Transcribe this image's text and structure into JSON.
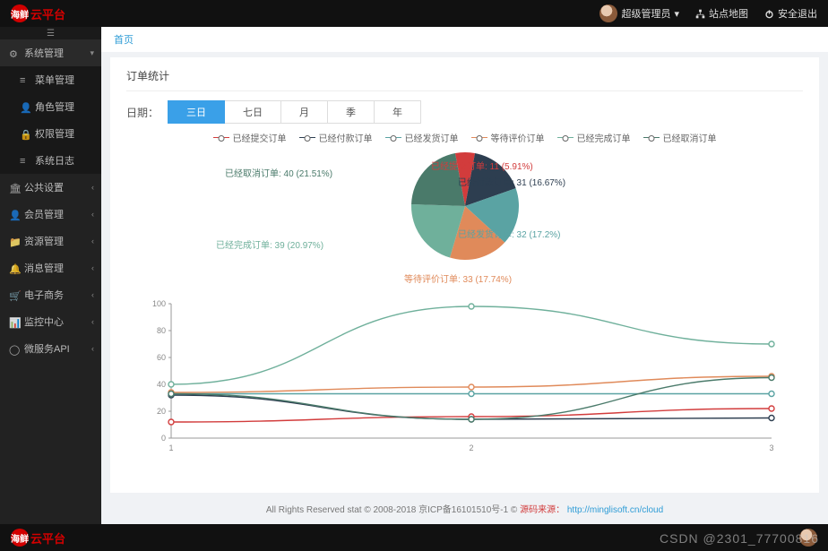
{
  "brand": {
    "badge": "海鲜",
    "text": "云平台"
  },
  "topbar": {
    "user": "超级管理员",
    "sitemap": "站点地图",
    "logout": "安全退出"
  },
  "sidebar": {
    "groups": [
      {
        "icon": "gears",
        "label": "系统管理",
        "caret": "down",
        "active": true
      },
      {
        "sub": true,
        "icon": "list",
        "label": "菜单管理"
      },
      {
        "sub": true,
        "icon": "user",
        "label": "角色管理"
      },
      {
        "sub": true,
        "icon": "lock",
        "label": "权限管理"
      },
      {
        "sub": true,
        "icon": "list",
        "label": "系统日志"
      },
      {
        "icon": "bank",
        "label": "公共设置",
        "caret": "left"
      },
      {
        "icon": "user",
        "label": "会员管理",
        "caret": "left"
      },
      {
        "icon": "folder",
        "label": "资源管理",
        "caret": "left"
      },
      {
        "icon": "bell",
        "label": "消息管理",
        "caret": "left"
      },
      {
        "icon": "cart",
        "label": "电子商务",
        "caret": "left"
      },
      {
        "icon": "monitor",
        "label": "监控中心",
        "caret": "left"
      },
      {
        "icon": "circle",
        "label": "微服务API",
        "caret": "left"
      }
    ]
  },
  "breadcrumb": "首页",
  "panel": {
    "title": "订单统计",
    "date_label": "日期：",
    "ranges": [
      "三日",
      "七日",
      "月",
      "季",
      "年"
    ],
    "active_range": 0
  },
  "chart_data": [
    {
      "type": "pie",
      "title": "",
      "series": [
        {
          "name": "已经提交订单",
          "value": 11,
          "pct": 5.91,
          "color": "#d23c3c"
        },
        {
          "name": "已经付款订单",
          "value": 31,
          "pct": 16.67,
          "color": "#2d3e50"
        },
        {
          "name": "已经发货订单",
          "value": 32,
          "pct": 17.2,
          "color": "#5aa3a3"
        },
        {
          "name": "等待评价订单",
          "value": 33,
          "pct": 17.74,
          "color": "#e08a5a"
        },
        {
          "name": "已经完成订单",
          "value": 39,
          "pct": 20.97,
          "color": "#6fb09b"
        },
        {
          "name": "已经取消订单",
          "value": 40,
          "pct": 21.51,
          "color": "#4a7a6a"
        }
      ]
    },
    {
      "type": "line",
      "x": [
        1,
        2,
        3
      ],
      "xlabel": "",
      "ylabel": "",
      "ylim": [
        0,
        100
      ],
      "yticks": [
        0,
        20,
        40,
        60,
        80,
        100
      ],
      "series": [
        {
          "name": "已经提交订单",
          "color": "#d23c3c",
          "values": [
            12,
            16,
            22
          ]
        },
        {
          "name": "已经付款订单",
          "color": "#2d3e50",
          "values": [
            32,
            14,
            15
          ]
        },
        {
          "name": "已经发货订单",
          "color": "#5aa3a3",
          "values": [
            33,
            33,
            33
          ]
        },
        {
          "name": "等待评价订单",
          "color": "#e08a5a",
          "values": [
            34,
            38,
            46
          ]
        },
        {
          "name": "已经完成订单",
          "color": "#6fb09b",
          "values": [
            40,
            98,
            70
          ]
        },
        {
          "name": "已经取消订单",
          "color": "#4a7a6a",
          "values": [
            33,
            14,
            45
          ]
        }
      ]
    }
  ],
  "footer": {
    "text_prefix": "All Rights Reserved stat © 2008-2018 京ICP备16101510号-1 © ",
    "src_label": "源码来源：",
    "link_text": "http://minglisoft.cn/cloud",
    "link_href": "#"
  },
  "watermark": "CSDN @2301_77700816"
}
